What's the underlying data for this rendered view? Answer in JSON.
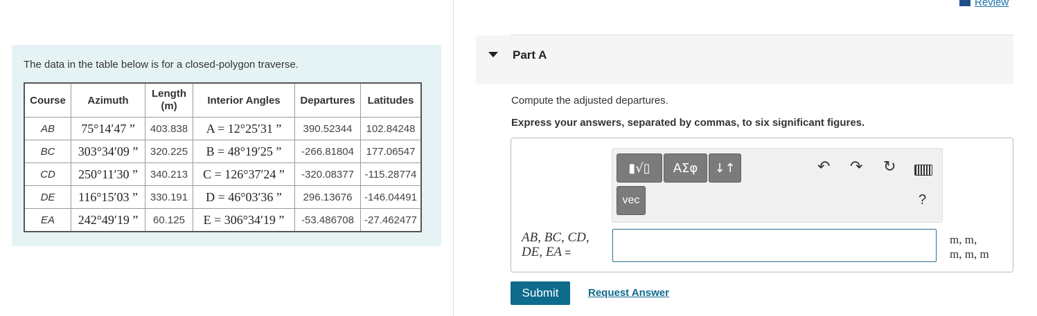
{
  "left": {
    "intro": "The data in the table below is for a closed-polygon traverse.",
    "headers": {
      "course": "Course",
      "azimuth": "Azimuth",
      "length_line1": "Length",
      "length_line2": "(m)",
      "interior": "Interior Angles",
      "departures": "Departures",
      "latitudes": "Latitudes"
    },
    "rows": [
      {
        "course": "AB",
        "azimuth": "75°14′47 ”",
        "length": "403.838",
        "interior": "A = 12°25′31 ”",
        "departure": "390.52344",
        "latitude": "102.84248"
      },
      {
        "course": "BC",
        "azimuth": "303°34′09 ”",
        "length": "320.225",
        "interior": "B = 48°19′25 ”",
        "departure": "-266.81804",
        "latitude": "177.06547"
      },
      {
        "course": "CD",
        "azimuth": "250°11′30 ”",
        "length": "340.213",
        "interior": "C = 126°37′24 ”",
        "departure": "-320.08377",
        "latitude": "-115.28774"
      },
      {
        "course": "DE",
        "azimuth": "116°15′03 ”",
        "length": "330.191",
        "interior": "D = 46°03′36 ”",
        "departure": "296.13676",
        "latitude": "-146.04491"
      },
      {
        "course": "EA",
        "azimuth": "242°49′19 ”",
        "length": "60.125",
        "interior": "E = 306°34′19 ”",
        "departure": "-53.486708",
        "latitude": "-27.462477"
      }
    ]
  },
  "right": {
    "review_label": "Review",
    "part_label": "Part A",
    "question": "Compute the adjusted departures.",
    "instruction": "Express your answers, separated by commas, to six significant figures.",
    "toolbar": {
      "templates_label": "▮√▯",
      "symbols_label": "ΑΣφ",
      "arrows_label": "↓↑",
      "vec_label": "vec",
      "undo_icon": "↶",
      "redo_icon": "↷",
      "reset_icon": "↻",
      "help_label": "?"
    },
    "eq_label_line1": "AB, BC, CD,",
    "eq_label_line2": "DE, EA",
    "eq_sign": " =",
    "answer_value": "",
    "units_line1": "m, m,",
    "units_line2": "m, m, m",
    "submit_label": "Submit",
    "request_label": "Request Answer"
  }
}
